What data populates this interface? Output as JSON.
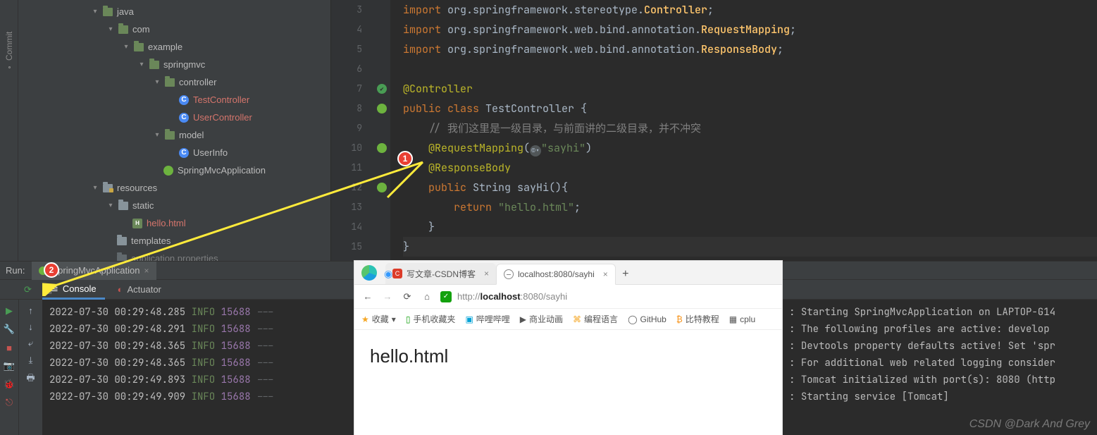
{
  "siderail": {
    "commit": "Commit"
  },
  "tree": {
    "java": "java",
    "com": "com",
    "example": "example",
    "springmvc": "springmvc",
    "controller": "controller",
    "testController": "TestController",
    "userController": "UserController",
    "model": "model",
    "userInfo": "UserInfo",
    "springApp": "SpringMvcApplication",
    "resources": "resources",
    "static": "static",
    "helloHtml": "hello.html",
    "templates": "templates",
    "appProps": "application.properties"
  },
  "editor": {
    "lines": {
      "l3a": "import ",
      "l3b": "org.springframework.stereotype.",
      "l3c": "Controller",
      "l3d": ";",
      "l4a": "import ",
      "l4b": "org.springframework.web.bind.annotation.",
      "l4c": "RequestMapping",
      "l4d": ";",
      "l5a": "import ",
      "l5b": "org.springframework.web.bind.annotation.",
      "l5c": "ResponseBody",
      "l5d": ";",
      "l7": "@Controller",
      "l8a": "public class ",
      "l8b": "TestController ",
      "l8c": "{",
      "l9": "// 我们这里是一级目录，与前面讲的二级目录，并不冲突",
      "l10a": "@RequestMapping",
      "l10b": "(",
      "l10c": "\"sayhi\"",
      "l10d": ")",
      "l11": "@ResponseBody",
      "l12a": "public ",
      "l12b": "String sayHi(){",
      "l13a": "return ",
      "l13b": "\"hello.html\"",
      "l13c": ";",
      "l14": "}",
      "l15": "}"
    },
    "lineNumbers": [
      "3",
      "4",
      "5",
      "6",
      "7",
      "8",
      "9",
      "10",
      "11",
      "12",
      "13",
      "14",
      "15"
    ]
  },
  "run": {
    "title": "Run:",
    "config": "SpringMvcApplication",
    "tabs": {
      "console": "Console",
      "actuator": "Actuator"
    },
    "logs": [
      {
        "ts": "2022-07-30 00:29:48.285",
        "lvl": "INFO",
        "pid": "15688",
        "dash": "---",
        "msg": "Starting SpringMvcApplication on LAPTOP-G14"
      },
      {
        "ts": "2022-07-30 00:29:48.291",
        "lvl": "INFO",
        "pid": "15688",
        "dash": "---",
        "msg": "The following profiles are active: develop"
      },
      {
        "ts": "2022-07-30 00:29:48.365",
        "lvl": "INFO",
        "pid": "15688",
        "dash": "---",
        "msg": "Devtools property defaults active! Set 'spr"
      },
      {
        "ts": "2022-07-30 00:29:48.365",
        "lvl": "INFO",
        "pid": "15688",
        "dash": "---",
        "msg": "For additional web related logging consider"
      },
      {
        "ts": "2022-07-30 00:29:49.893",
        "lvl": "INFO",
        "pid": "15688",
        "dash": "---",
        "msg": "Tomcat initialized with port(s): 8080 (http"
      },
      {
        "ts": "2022-07-30 00:29:49.909",
        "lvl": "INFO",
        "pid": "15688",
        "dash": "---",
        "msg": "Starting service [Tomcat]"
      }
    ]
  },
  "browser": {
    "tab1": "写文章-CSDN博客",
    "tab2": "localhost:8080/sayhi",
    "url_proto": "http://",
    "url_host": "localhost",
    "url_port_path": ":8080/sayhi",
    "bookmarks": {
      "fav": "收藏",
      "mobile": "手机收藏夹",
      "bili": "哔哩哔哩",
      "anime": "商业动画",
      "code": "编程语言",
      "github": "GitHub",
      "bitcoin": "比特教程",
      "cplus": "cplu"
    },
    "page_text": "hello.html",
    "sync": "◉"
  },
  "badges": {
    "one": "1",
    "two": "2"
  },
  "watermark": "CSDN @Dark And Grey"
}
